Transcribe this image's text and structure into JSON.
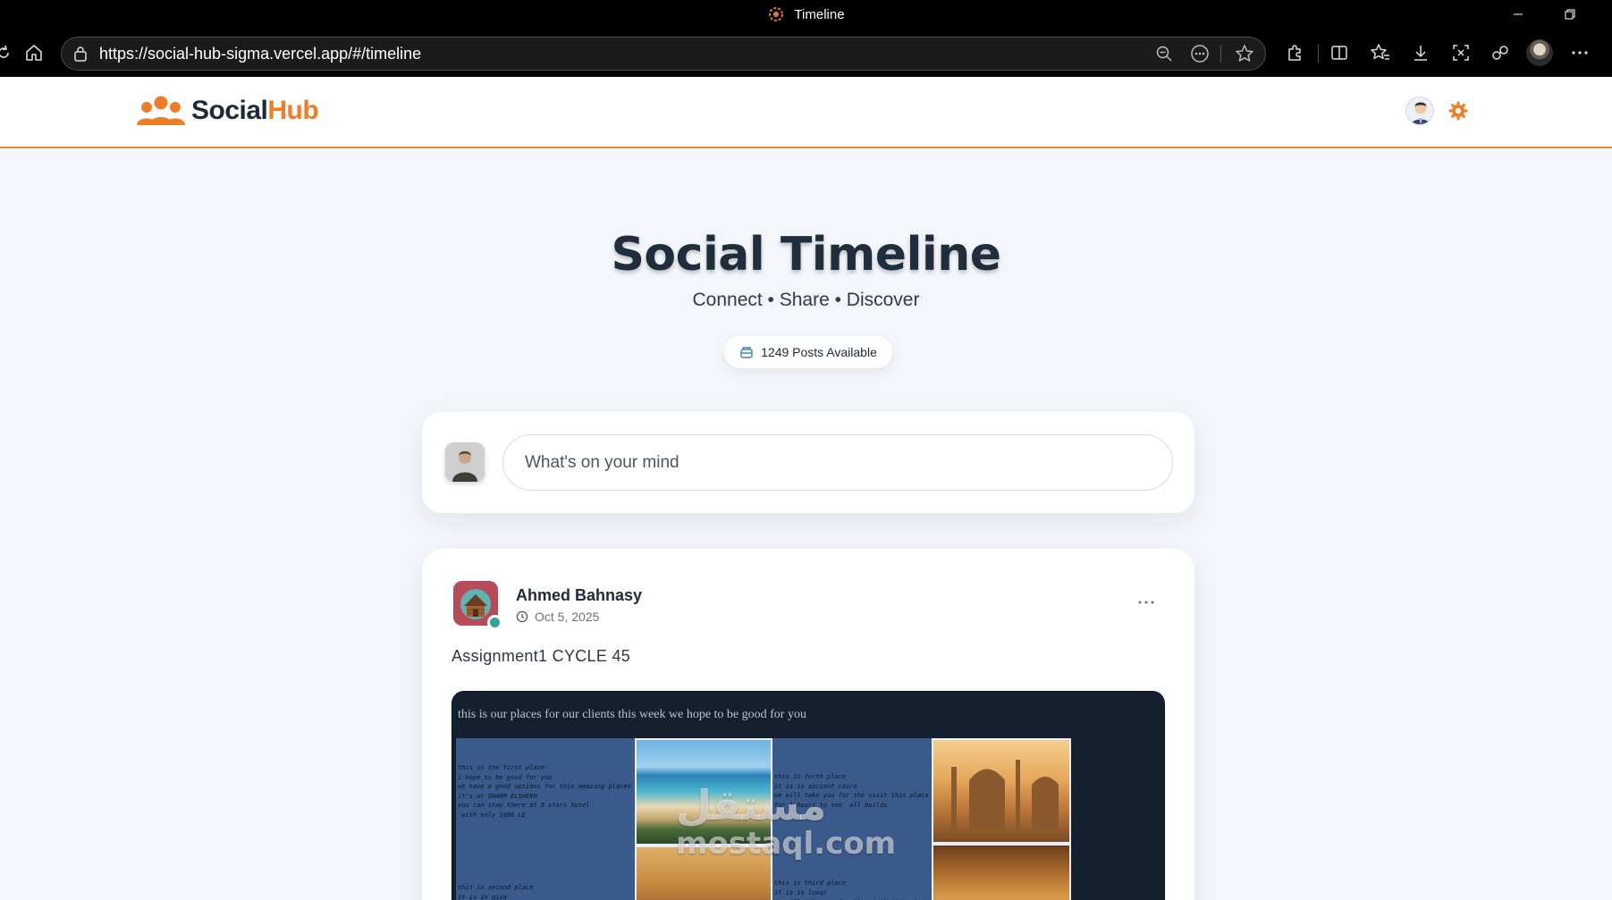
{
  "browser": {
    "tab_title": "Timeline",
    "url": "https://social-hub-sigma.vercel.app/#/timeline",
    "icons": [
      "reload-icon",
      "home-icon",
      "lock-icon",
      "zoom-out-icon",
      "reading-mode-icon",
      "favorite-star-icon",
      "extensions-icon",
      "split-screen-icon",
      "favorites-icon",
      "download-icon",
      "screenshot-icon",
      "copilot-icon",
      "profile-avatar",
      "more-menu-icon"
    ]
  },
  "header": {
    "brand_social": "Social",
    "brand_hub": "Hub",
    "accent_color": "#ef7d27"
  },
  "hero": {
    "title": "Social Timeline",
    "subtitle": "Connect • Share • Discover",
    "posts_count": "1249 Posts Available"
  },
  "composer": {
    "placeholder": "What's on your mind"
  },
  "post": {
    "author": "Ahmed Bahnasy",
    "date": "Oct 5, 2025",
    "text": "Assignment1 CYCLE 45",
    "image": {
      "caption": "this is our places for our clients this week we hope to be good for you",
      "note_1": "this is the first place\ni hope to be good for you\nwe have a good options for this amazing places\nit's at SHARM ELSHEKH\nyou can stay there at 5 stars hotel\n with only 1000 LE",
      "note_2": "this is forth place\nit is in ancient cairo\nwe will take you for the visit this place\nfor 6 hours to see  all builds",
      "note_3": "this is second place\nit is in giza",
      "note_4": "this is third place\nit is in luxor\nwe will take you for the visit this place",
      "watermark_arabic": "مستقل",
      "watermark_latin": "mostaql.com"
    }
  }
}
